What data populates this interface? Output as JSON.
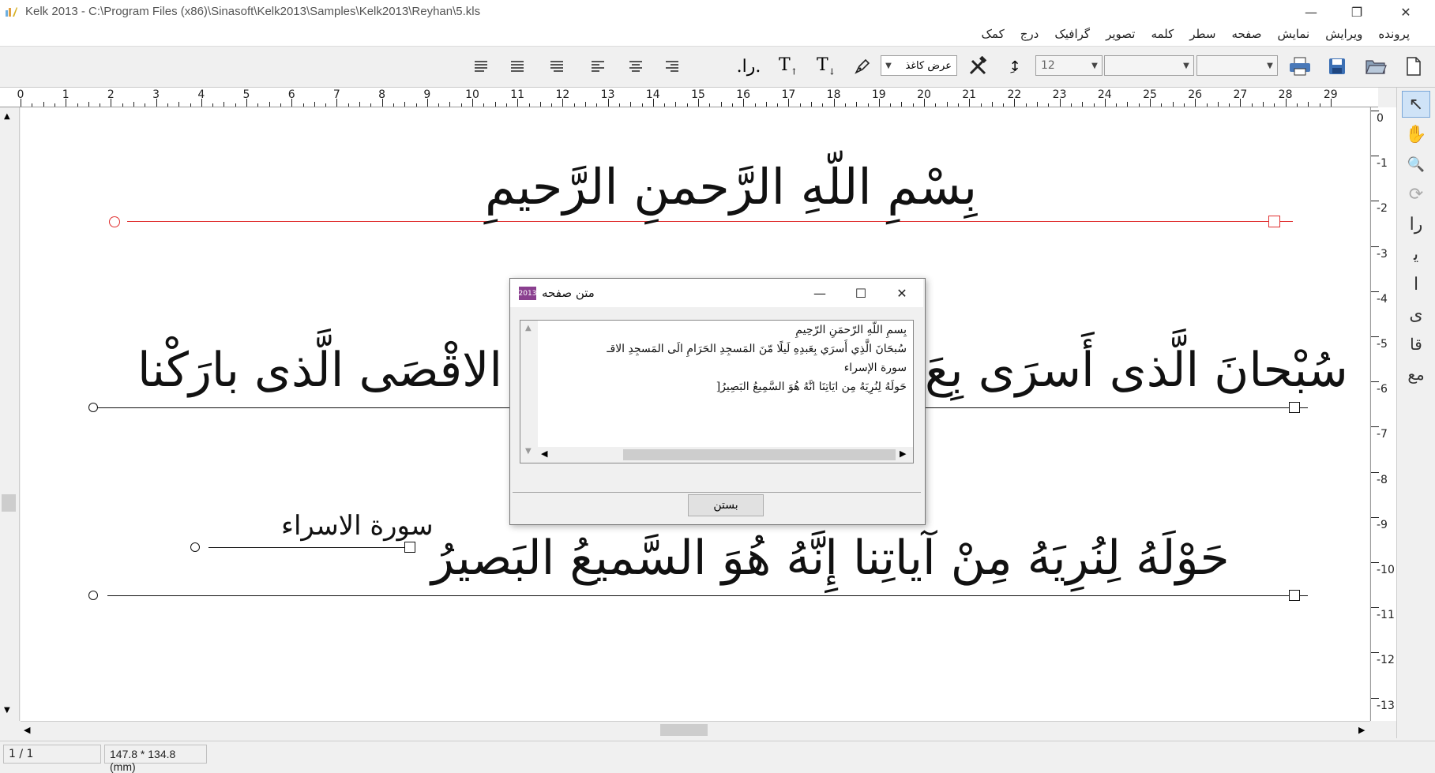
{
  "window": {
    "title": "Kelk 2013 - C:\\Program Files (x86)\\Sinasoft\\Kelk2013\\Samples\\Kelk2013\\Reyhan\\5.kls",
    "minimize": "—",
    "restore": "❐",
    "close": "✕"
  },
  "menu": {
    "items": [
      "پرونده",
      "ویرایش",
      "نمایش",
      "صفحه",
      "سطر",
      "کلمه",
      "تصویر",
      "گرافیک",
      "درج",
      "کمک"
    ]
  },
  "toolbar": {
    "font_size": "12",
    "paper_width_label": "عرض کاغذ",
    "icons": [
      "new-document-icon",
      "open-folder-icon",
      "save-icon",
      "print-icon"
    ]
  },
  "ruler": {
    "h_ticks": [
      "0",
      "1",
      "2",
      "3",
      "4",
      "5",
      "6",
      "7",
      "8",
      "9",
      "10",
      "11",
      "12",
      "13",
      "14",
      "15",
      "16",
      "17",
      "18",
      "19",
      "20",
      "21",
      "22",
      "23",
      "24",
      "25",
      "26",
      "27",
      "28",
      "29"
    ],
    "v_ticks": [
      "0",
      "-1",
      "-2",
      "-3",
      "-4",
      "-5",
      "-6",
      "-7",
      "-8",
      "-9",
      "-10",
      "-11",
      "-12",
      "-13"
    ]
  },
  "canvas": {
    "line1": "بِسْمِ اللّهِ الرَّحمنِ الرَّحیمِ",
    "line2_right": "سُبْحانَ الَّذی أَسرَی بِعَ",
    "line2_left": "ی المَسجِدِ الاقْصَی الَّذی بارَکْنا",
    "line3": "سورة الاسراء",
    "line4": "حَوْلَهُ لِنُرِيَهُ مِنْ آياتِنا إِنَّهُ هُوَ السَّميعُ البَصيرُ"
  },
  "dialog": {
    "title": "متن صفحه",
    "icon_text": "2013",
    "minimize": "—",
    "maximize": "☐",
    "close": "✕",
    "text_lines": [
      "بِسمِ اللّهِ الرّحمَنِ الرّحِيمِ",
      "سُبحَانَ الَّذِي أَسرَي بِعَبدِهِ لَيلًا مّنَ المَسجِدِ الحَرَامِ الَى المَسجِدِ الاقـ",
      "سورة الإسراء",
      "حَولَهُ لِنُرِيَهُ مِن ايَاتِنَا انَّهُ هُوَ السَّمِيعُ البَصِيرُ["
    ],
    "ok_label": "بستن"
  },
  "status": {
    "page": "1 / 1",
    "size": "147.8 * 134.8 (mm)"
  },
  "palette": {
    "glyphs": [
      "↖",
      "✋",
      "🔍",
      "⟳",
      "ﺭﺍ",
      "ﯾ",
      "ﺍ",
      "ﯼ",
      "ﻗﺎ",
      "ﻣﻊ"
    ]
  }
}
